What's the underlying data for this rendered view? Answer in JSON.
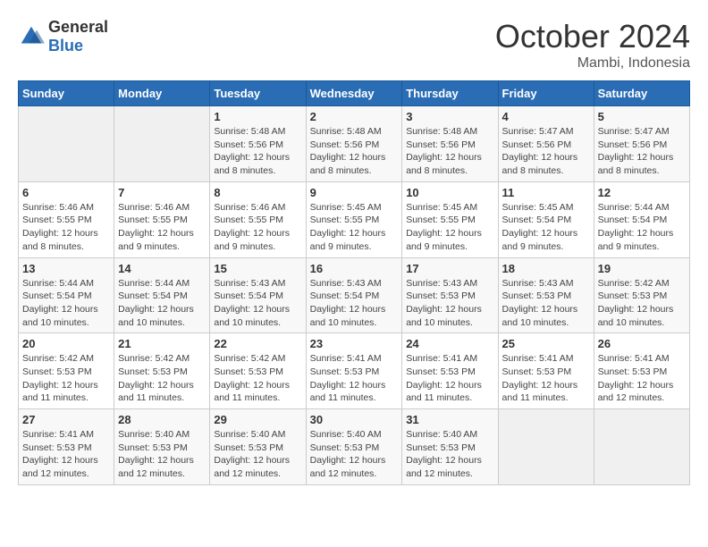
{
  "header": {
    "logo_general": "General",
    "logo_blue": "Blue",
    "month_title": "October 2024",
    "location": "Mambi, Indonesia"
  },
  "days_of_week": [
    "Sunday",
    "Monday",
    "Tuesday",
    "Wednesday",
    "Thursday",
    "Friday",
    "Saturday"
  ],
  "weeks": [
    [
      {
        "day": "",
        "info": ""
      },
      {
        "day": "",
        "info": ""
      },
      {
        "day": "1",
        "info": "Sunrise: 5:48 AM\nSunset: 5:56 PM\nDaylight: 12 hours and 8 minutes."
      },
      {
        "day": "2",
        "info": "Sunrise: 5:48 AM\nSunset: 5:56 PM\nDaylight: 12 hours and 8 minutes."
      },
      {
        "day": "3",
        "info": "Sunrise: 5:48 AM\nSunset: 5:56 PM\nDaylight: 12 hours and 8 minutes."
      },
      {
        "day": "4",
        "info": "Sunrise: 5:47 AM\nSunset: 5:56 PM\nDaylight: 12 hours and 8 minutes."
      },
      {
        "day": "5",
        "info": "Sunrise: 5:47 AM\nSunset: 5:56 PM\nDaylight: 12 hours and 8 minutes."
      }
    ],
    [
      {
        "day": "6",
        "info": "Sunrise: 5:46 AM\nSunset: 5:55 PM\nDaylight: 12 hours and 8 minutes."
      },
      {
        "day": "7",
        "info": "Sunrise: 5:46 AM\nSunset: 5:55 PM\nDaylight: 12 hours and 9 minutes."
      },
      {
        "day": "8",
        "info": "Sunrise: 5:46 AM\nSunset: 5:55 PM\nDaylight: 12 hours and 9 minutes."
      },
      {
        "day": "9",
        "info": "Sunrise: 5:45 AM\nSunset: 5:55 PM\nDaylight: 12 hours and 9 minutes."
      },
      {
        "day": "10",
        "info": "Sunrise: 5:45 AM\nSunset: 5:55 PM\nDaylight: 12 hours and 9 minutes."
      },
      {
        "day": "11",
        "info": "Sunrise: 5:45 AM\nSunset: 5:54 PM\nDaylight: 12 hours and 9 minutes."
      },
      {
        "day": "12",
        "info": "Sunrise: 5:44 AM\nSunset: 5:54 PM\nDaylight: 12 hours and 9 minutes."
      }
    ],
    [
      {
        "day": "13",
        "info": "Sunrise: 5:44 AM\nSunset: 5:54 PM\nDaylight: 12 hours and 10 minutes."
      },
      {
        "day": "14",
        "info": "Sunrise: 5:44 AM\nSunset: 5:54 PM\nDaylight: 12 hours and 10 minutes."
      },
      {
        "day": "15",
        "info": "Sunrise: 5:43 AM\nSunset: 5:54 PM\nDaylight: 12 hours and 10 minutes."
      },
      {
        "day": "16",
        "info": "Sunrise: 5:43 AM\nSunset: 5:54 PM\nDaylight: 12 hours and 10 minutes."
      },
      {
        "day": "17",
        "info": "Sunrise: 5:43 AM\nSunset: 5:53 PM\nDaylight: 12 hours and 10 minutes."
      },
      {
        "day": "18",
        "info": "Sunrise: 5:43 AM\nSunset: 5:53 PM\nDaylight: 12 hours and 10 minutes."
      },
      {
        "day": "19",
        "info": "Sunrise: 5:42 AM\nSunset: 5:53 PM\nDaylight: 12 hours and 10 minutes."
      }
    ],
    [
      {
        "day": "20",
        "info": "Sunrise: 5:42 AM\nSunset: 5:53 PM\nDaylight: 12 hours and 11 minutes."
      },
      {
        "day": "21",
        "info": "Sunrise: 5:42 AM\nSunset: 5:53 PM\nDaylight: 12 hours and 11 minutes."
      },
      {
        "day": "22",
        "info": "Sunrise: 5:42 AM\nSunset: 5:53 PM\nDaylight: 12 hours and 11 minutes."
      },
      {
        "day": "23",
        "info": "Sunrise: 5:41 AM\nSunset: 5:53 PM\nDaylight: 12 hours and 11 minutes."
      },
      {
        "day": "24",
        "info": "Sunrise: 5:41 AM\nSunset: 5:53 PM\nDaylight: 12 hours and 11 minutes."
      },
      {
        "day": "25",
        "info": "Sunrise: 5:41 AM\nSunset: 5:53 PM\nDaylight: 12 hours and 11 minutes."
      },
      {
        "day": "26",
        "info": "Sunrise: 5:41 AM\nSunset: 5:53 PM\nDaylight: 12 hours and 12 minutes."
      }
    ],
    [
      {
        "day": "27",
        "info": "Sunrise: 5:41 AM\nSunset: 5:53 PM\nDaylight: 12 hours and 12 minutes."
      },
      {
        "day": "28",
        "info": "Sunrise: 5:40 AM\nSunset: 5:53 PM\nDaylight: 12 hours and 12 minutes."
      },
      {
        "day": "29",
        "info": "Sunrise: 5:40 AM\nSunset: 5:53 PM\nDaylight: 12 hours and 12 minutes."
      },
      {
        "day": "30",
        "info": "Sunrise: 5:40 AM\nSunset: 5:53 PM\nDaylight: 12 hours and 12 minutes."
      },
      {
        "day": "31",
        "info": "Sunrise: 5:40 AM\nSunset: 5:53 PM\nDaylight: 12 hours and 12 minutes."
      },
      {
        "day": "",
        "info": ""
      },
      {
        "day": "",
        "info": ""
      }
    ]
  ]
}
